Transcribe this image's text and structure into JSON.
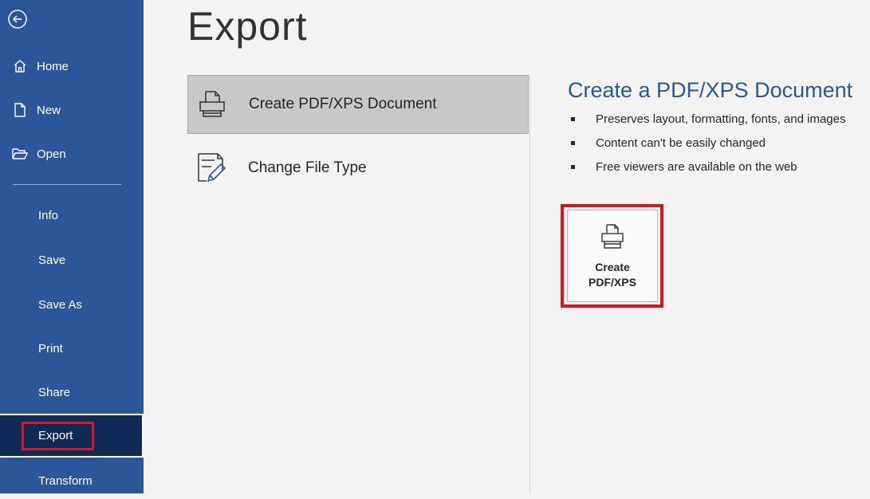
{
  "sidebar": {
    "items": [
      {
        "label": "Home",
        "icon": "home-icon"
      },
      {
        "label": "New",
        "icon": "new-document-icon"
      },
      {
        "label": "Open",
        "icon": "folder-open-icon"
      },
      {
        "label": "Info"
      },
      {
        "label": "Save"
      },
      {
        "label": "Save As"
      },
      {
        "label": "Print"
      },
      {
        "label": "Share"
      },
      {
        "label": "Export",
        "selected": true
      },
      {
        "label": "Transform"
      }
    ],
    "back_icon": "back-arrow-icon",
    "background_color": "#2b579a",
    "selected_color": "#0e2a57"
  },
  "main": {
    "title": "Export",
    "options": [
      {
        "label": "Create PDF/XPS Document",
        "icon": "pdf-xps-icon",
        "selected": true
      },
      {
        "label": "Change File Type",
        "icon": "change-file-type-icon"
      }
    ],
    "detail": {
      "title": "Create a PDF/XPS Document",
      "bullets": [
        "Preserves layout, formatting, fonts, and images",
        "Content can't be easily changed",
        "Free viewers are available on the web"
      ],
      "button": {
        "line1": "Create",
        "line2": "PDF/XPS",
        "icon": "pdf-xps-icon"
      }
    },
    "accent_color": "#2b579a",
    "highlight_color": "#e0121c"
  }
}
